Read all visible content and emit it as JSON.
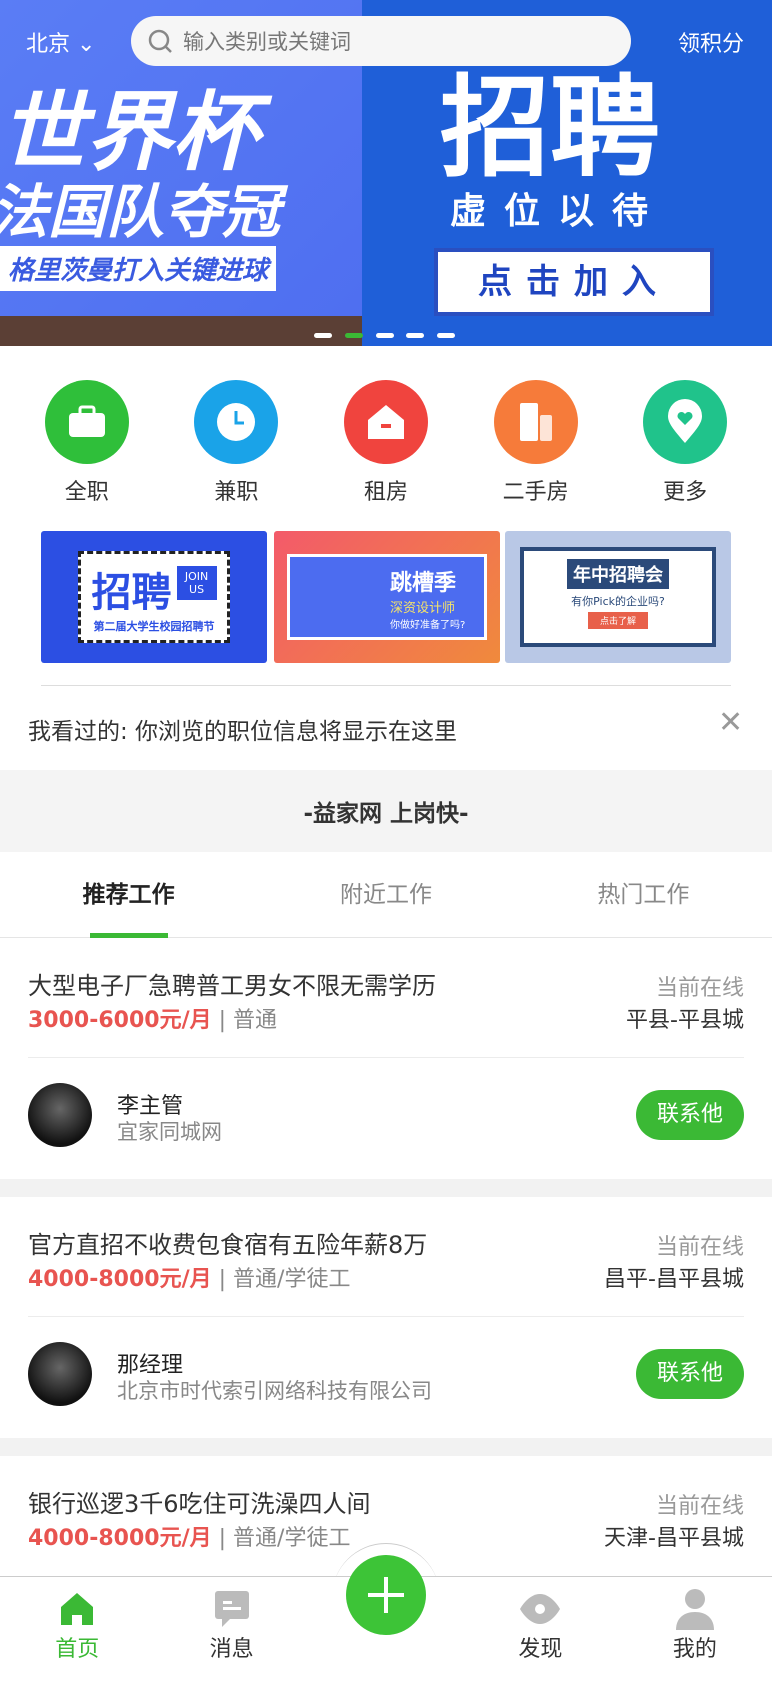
{
  "header": {
    "city": "北京",
    "search_placeholder": "输入类别或关键词",
    "points": "领积分"
  },
  "banner": {
    "left_title": "世界杯",
    "left_sub": "法国队夺冠",
    "left_caption": "格里茨曼打入关键进球",
    "right_title": "招聘",
    "right_sub": "虚位以待",
    "right_button": "点击加入",
    "active_dot": 2,
    "dot_count": 5
  },
  "categories": [
    {
      "label": "全职",
      "icon": "briefcase-icon",
      "color": "#2fbf3a"
    },
    {
      "label": "兼职",
      "icon": "clock-icon",
      "color": "#1aa3e8"
    },
    {
      "label": "租房",
      "icon": "house-icon",
      "color": "#f0443e"
    },
    {
      "label": "二手房",
      "icon": "building-icon",
      "color": "#f67b3a"
    },
    {
      "label": "更多",
      "icon": "heart-pin-icon",
      "color": "#20c38b"
    }
  ],
  "promos": [
    {
      "title": "招聘",
      "badge": "JOIN US",
      "sub": "第二届大学生校园招聘节"
    },
    {
      "title": "跳槽季",
      "sub": "深资设计师",
      "sub2": "你做好准备了吗?"
    },
    {
      "title": "年中招聘会",
      "sub": "有你Pick的企业吗?",
      "btn": "点击了解"
    }
  ],
  "history": {
    "text": "我看过的: 你浏览的职位信息将显示在这里"
  },
  "section_title": "-益家网 上岗快-",
  "tabs": [
    {
      "label": "推荐工作"
    },
    {
      "label": "附近工作"
    },
    {
      "label": "热门工作"
    }
  ],
  "jobs": [
    {
      "title": "大型电子厂急聘普工男女不限无需学历",
      "salary": "3000-6000元/月",
      "type": "| 普通",
      "status": "当前在线",
      "location": "平县-平县城",
      "contact": "李主管",
      "company": "宜家同城网",
      "button": "联系他"
    },
    {
      "title": "官方直招不收费包食宿有五险年薪8万",
      "salary": "4000-8000元/月",
      "type": "| 普通/学徒工",
      "status": "当前在线",
      "location": "昌平-昌平县城",
      "contact": "那经理",
      "company": "北京市时代索引网络科技有限公司",
      "button": "联系他"
    },
    {
      "title": "银行巡逻3千6吃住可洗澡四人间",
      "salary": "4000-8000元/月",
      "type": "| 普通/学徒工",
      "status": "当前在线",
      "location": "天津-昌平县城"
    }
  ],
  "nav": [
    {
      "label": "首页",
      "icon": "home-icon"
    },
    {
      "label": "消息",
      "icon": "message-icon"
    },
    {
      "label": "发现",
      "icon": "eye-icon"
    },
    {
      "label": "我的",
      "icon": "user-icon"
    }
  ],
  "colors": {
    "accent": "#3bb935",
    "salary": "#e85450"
  }
}
